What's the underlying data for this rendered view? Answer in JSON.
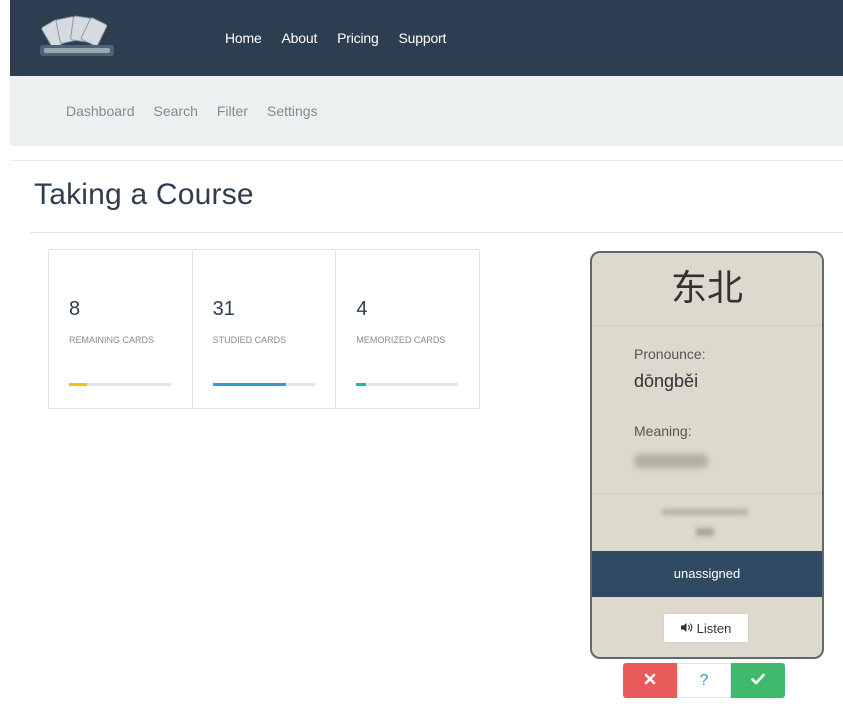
{
  "colors": {
    "navbar": "#2d3e50",
    "remaining_bar": "#f1c40f",
    "studied_bar": "#3498db",
    "memorized_bar": "#1abc9c",
    "card_status_bg": "#304a63",
    "wrong": "#e95a5a",
    "right": "#3fb96d"
  },
  "nav": {
    "items": [
      "Home",
      "About",
      "Pricing",
      "Support"
    ]
  },
  "subnav": {
    "items": [
      "Dashboard",
      "Search",
      "Filter",
      "Settings"
    ]
  },
  "page": {
    "title": "Taking a Course"
  },
  "stats": [
    {
      "value": "8",
      "label": "REMAINING CARDS",
      "progress": 0.18
    },
    {
      "value": "31",
      "label": "STUDIED CARDS",
      "progress": 0.72
    },
    {
      "value": "4",
      "label": "MEMORIZED CARDS",
      "progress": 0.09
    }
  ],
  "card": {
    "word": "东北",
    "pronounce_label": "Pronounce:",
    "pronunciation": "dōngběi",
    "meaning_label": "Meaning:",
    "status": "unassigned",
    "listen_label": "Listen",
    "listen_icon": "speaker-icon"
  },
  "answers": {
    "wrong_icon": "close-icon",
    "unsure_text": "?",
    "right_icon": "check-icon"
  }
}
